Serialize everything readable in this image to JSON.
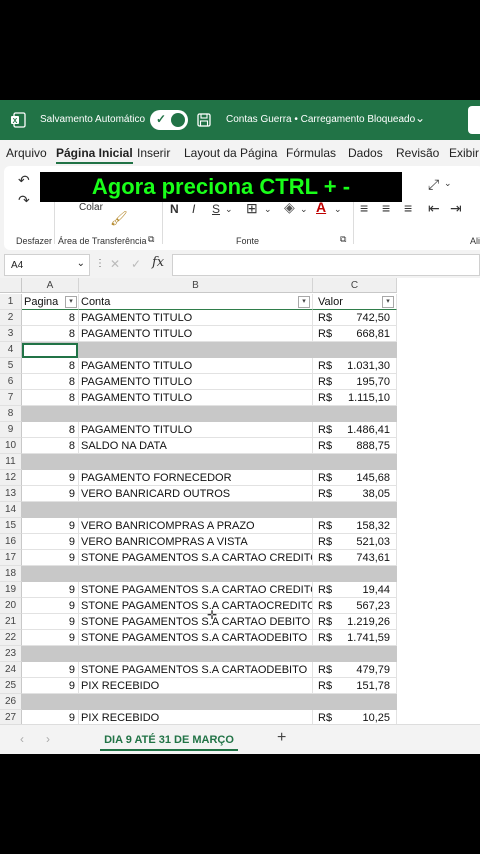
{
  "titlebar": {
    "autosave_label": "Salvamento Automático",
    "doc_title": "Contas Guerra • Carregamento Bloqueado",
    "chevron": "⌄"
  },
  "tabs": [
    "Arquivo",
    "Página Inicial",
    "Inserir",
    "Layout da Página",
    "Fórmulas",
    "Dados",
    "Revisão",
    "Exibir"
  ],
  "active_tab": "Página Inicial",
  "ribbon": {
    "undo_group": "Desfazer",
    "clipboard_group": "Área de Transferência",
    "paste_label": "Colar",
    "font_group": "Fonte",
    "bold": "N",
    "italic": "I",
    "underline": "S",
    "right_group": "Ali"
  },
  "overlay_text": "Agora preciona  CTRL + -",
  "formula_bar": {
    "name_box": "A4",
    "fx": "fx",
    "value": ""
  },
  "columns": [
    "A",
    "B",
    "C"
  ],
  "header_row": {
    "num": "1",
    "a": "Pagina",
    "b": "Conta",
    "c": "Valor"
  },
  "rows": [
    {
      "num": "2",
      "a": "8",
      "b": "PAGAMENTO TITULO",
      "cur": "R$",
      "c": "742,50"
    },
    {
      "num": "3",
      "a": "8",
      "b": "PAGAMENTO TITULO",
      "cur": "R$",
      "c": "668,81"
    },
    {
      "num": "4",
      "gray": true
    },
    {
      "num": "5",
      "a": "8",
      "b": "PAGAMENTO TITULO",
      "cur": "R$",
      "c": "1.031,30"
    },
    {
      "num": "6",
      "a": "8",
      "b": "PAGAMENTO TITULO",
      "cur": "R$",
      "c": "195,70"
    },
    {
      "num": "7",
      "a": "8",
      "b": "PAGAMENTO TITULO",
      "cur": "R$",
      "c": "1.115,10"
    },
    {
      "num": "8",
      "gray": true
    },
    {
      "num": "9",
      "a": "8",
      "b": "PAGAMENTO TITULO",
      "cur": "R$",
      "c": "1.486,41"
    },
    {
      "num": "10",
      "a": "8",
      "b": "SALDO NA DATA",
      "cur": "R$",
      "c": "888,75"
    },
    {
      "num": "11",
      "gray": true
    },
    {
      "num": "12",
      "a": "9",
      "b": "PAGAMENTO FORNECEDOR",
      "cur": "R$",
      "c": "145,68"
    },
    {
      "num": "13",
      "a": "9",
      "b": "VERO BANRICARD OUTROS",
      "cur": "R$",
      "c": "38,05"
    },
    {
      "num": "14",
      "gray": true
    },
    {
      "num": "15",
      "a": "9",
      "b": "VERO BANRICOMPRAS A PRAZO",
      "cur": "R$",
      "c": "158,32"
    },
    {
      "num": "16",
      "a": "9",
      "b": "VERO BANRICOMPRAS A VISTA",
      "cur": "R$",
      "c": "521,03"
    },
    {
      "num": "17",
      "a": "9",
      "b": "STONE PAGAMENTOS S.A CARTAO CREDITO",
      "cur": "R$",
      "c": "743,61"
    },
    {
      "num": "18",
      "gray": true
    },
    {
      "num": "19",
      "a": "9",
      "b": "STONE PAGAMENTOS S.A CARTAO CREDITO",
      "cur": "R$",
      "c": "19,44"
    },
    {
      "num": "20",
      "a": "9",
      "b": "STONE PAGAMENTOS S.A CARTAOCREDITO",
      "cur": "R$",
      "c": "567,23"
    },
    {
      "num": "21",
      "a": "9",
      "b": "STONE PAGAMENTOS S.A CARTAO DEBITO",
      "cur": "R$",
      "c": "1.219,26"
    },
    {
      "num": "22",
      "a": "9",
      "b": "STONE PAGAMENTOS S.A CARTAODEBITO",
      "cur": "R$",
      "c": "1.741,59"
    },
    {
      "num": "23",
      "gray": true
    },
    {
      "num": "24",
      "a": "9",
      "b": "STONE PAGAMENTOS S.A CARTAODEBITO",
      "cur": "R$",
      "c": "479,79"
    },
    {
      "num": "25",
      "a": "9",
      "b": "PIX RECEBIDO",
      "cur": "R$",
      "c": "151,78"
    },
    {
      "num": "26",
      "gray": true
    },
    {
      "num": "27",
      "a": "9",
      "b": "PIX RECEBIDO",
      "cur": "R$",
      "c": "10,25"
    }
  ],
  "sheet_tabs": {
    "prev": "‹",
    "next": "›",
    "active": "DIA 9 ATÉ 31 DE MARÇO",
    "add": "+"
  },
  "colors": {
    "excel_green": "#217346",
    "overlay_text": "#19ff19",
    "blank_row": "#c8c8c8"
  }
}
